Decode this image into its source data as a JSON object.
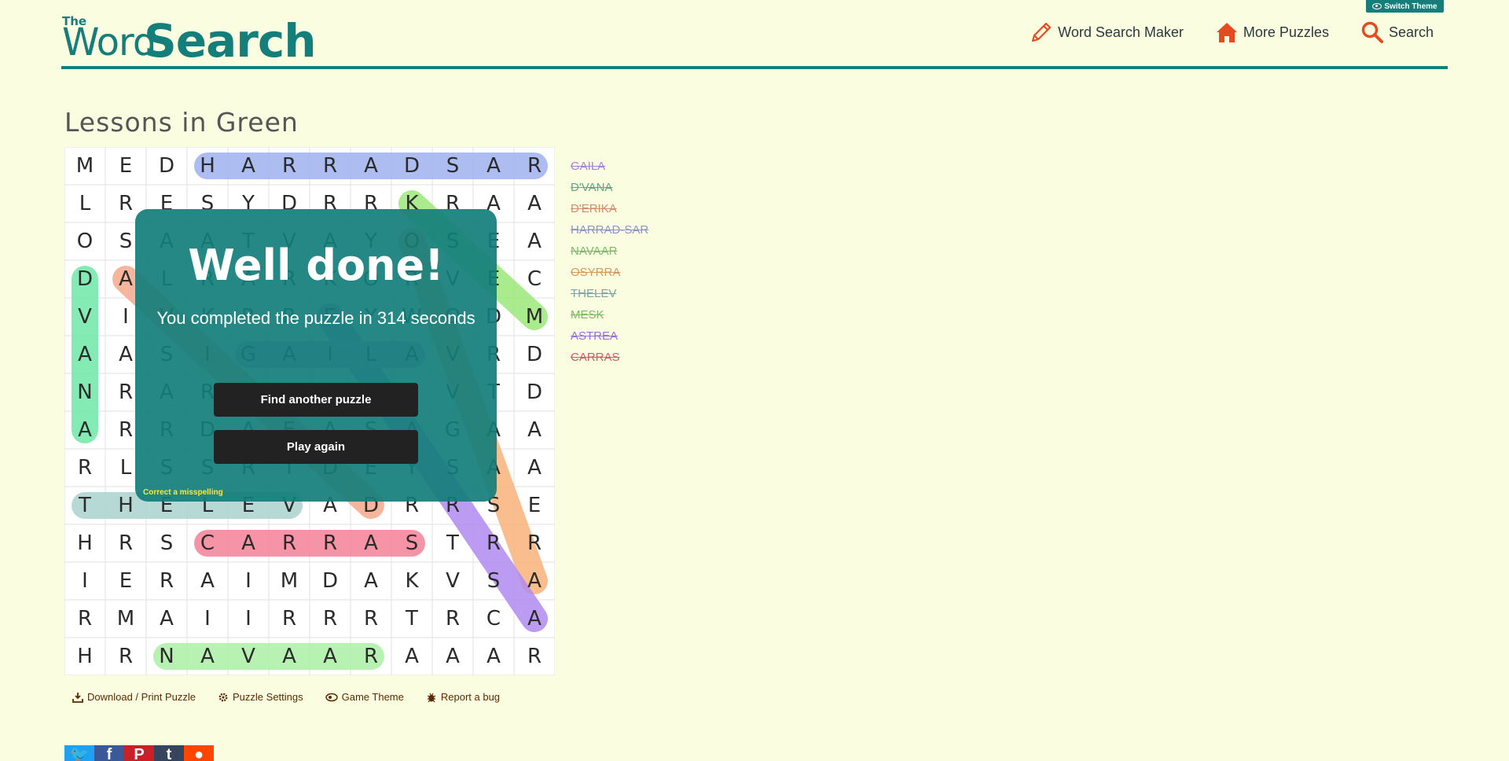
{
  "header": {
    "switch_theme": "Switch Theme",
    "logo_the": "The",
    "logo_word": "Word",
    "logo_search": "Search",
    "nav": [
      {
        "label": "Word Search Maker",
        "icon": "pencil-icon"
      },
      {
        "label": "More Puzzles",
        "icon": "home-icon"
      },
      {
        "label": "Search",
        "icon": "search-icon"
      }
    ]
  },
  "puzzle": {
    "title": "Lessons in Green",
    "grid": [
      "MEDHARRADSAR",
      "LRESYDRRKRAA",
      "OSAATVAYOSEA",
      "DALRARKORVEC",
      "VIVKRREYWODM",
      "AASIGAILAVRD",
      "NRARAEBESVTD",
      "ARRDAEASAGAA",
      "RLSSRTDEYSAA",
      "THELEVADRRSE",
      "HRSCARRASTRR",
      "IERAIMDAKVSA",
      "RMAIIRRRTRCA",
      "HRNAVAARAAAR"
    ],
    "words": [
      {
        "word": "GAILA",
        "color": "#a77fd6"
      },
      {
        "word": "D'VANA",
        "color": "#5fa87f"
      },
      {
        "word": "D'ERIKA",
        "color": "#d48c6a"
      },
      {
        "word": "HARRAD-SAR",
        "color": "#8b96c6"
      },
      {
        "word": "NAVAAR",
        "color": "#7fb86a"
      },
      {
        "word": "OSYRRA",
        "color": "#d49a5a"
      },
      {
        "word": "THELEV",
        "color": "#7aa6a6"
      },
      {
        "word": "MESK",
        "color": "#7fb86a"
      },
      {
        "word": "ASTREA",
        "color": "#9a6fd6"
      },
      {
        "word": "CARRAS",
        "color": "#d45a6a"
      }
    ]
  },
  "dialog": {
    "title": "Well done!",
    "message": "You completed the puzzle in 314 seconds",
    "find_another": "Find another puzzle",
    "play_again": "Play again",
    "misspelling": "Correct a misspelling"
  },
  "tools": [
    {
      "label": "Download / Print Puzzle",
      "icon": "download-icon"
    },
    {
      "label": "Puzzle Settings",
      "icon": "gear-icon"
    },
    {
      "label": "Game Theme",
      "icon": "eye-icon"
    },
    {
      "label": "Report a bug",
      "icon": "bug-icon"
    }
  ],
  "share": [
    {
      "name": "twitter-icon",
      "color": "#1da1f2"
    },
    {
      "name": "facebook-icon",
      "color": "#3b5998"
    },
    {
      "name": "pinterest-icon",
      "color": "#cb2027"
    },
    {
      "name": "tumblr-icon",
      "color": "#35465c"
    },
    {
      "name": "reddit-icon",
      "color": "#ff4500"
    }
  ]
}
